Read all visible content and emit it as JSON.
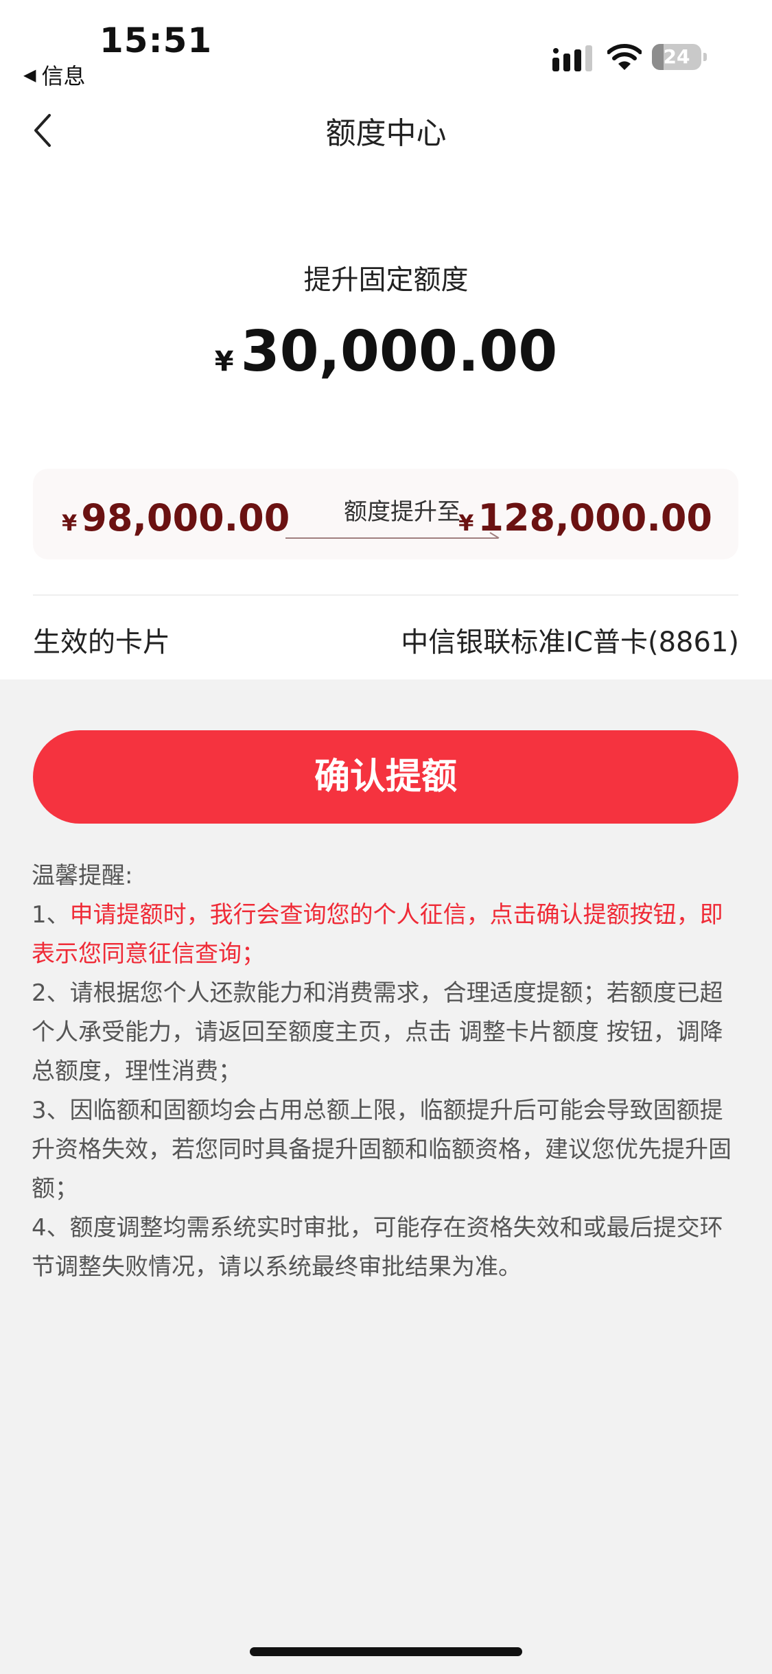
{
  "status_bar": {
    "time": "15:51",
    "back_app": "信息",
    "battery": "24",
    "battery_level": 0.24
  },
  "nav": {
    "title": "额度中心"
  },
  "limit": {
    "subtitle": "提升固定额度",
    "currency": "¥",
    "amount": "30,000.00"
  },
  "raise": {
    "from_currency": "¥",
    "from": "98,000.00",
    "label": "额度提升至",
    "to_currency": "¥",
    "to": "128,000.00"
  },
  "card": {
    "label": "生效的卡片",
    "value": "中信银联标准IC普卡(8861)"
  },
  "confirm_button": "确认提额",
  "tips": {
    "title": "温馨提醒:",
    "item1_prefix": "1、",
    "item1_red": "申请提额时，我行会查询您的个人征信，点击确认提额按钮，即表示您同意征信查询；",
    "item2": "2、请根据您个人还款能力和消费需求，合理适度提额；若额度已超个人承受能力，请返回至额度主页，点击 调整卡片额度 按钮，调降总额度，理性消费；",
    "item3": "3、因临额和固额均会占用总额上限，临额提升后可能会导致固额提升资格失效，若您同时具备提升固额和临额资格，建议您优先提升固额；",
    "item4": "4、额度调整均需系统实时审批，可能存在资格失效和或最后提交环节调整失败情况，请以系统最终审批结果为准。"
  },
  "colors": {
    "accent_red": "#f5333f",
    "tip_red": "#ef2b37",
    "amount_dark_red": "#6b1212"
  }
}
